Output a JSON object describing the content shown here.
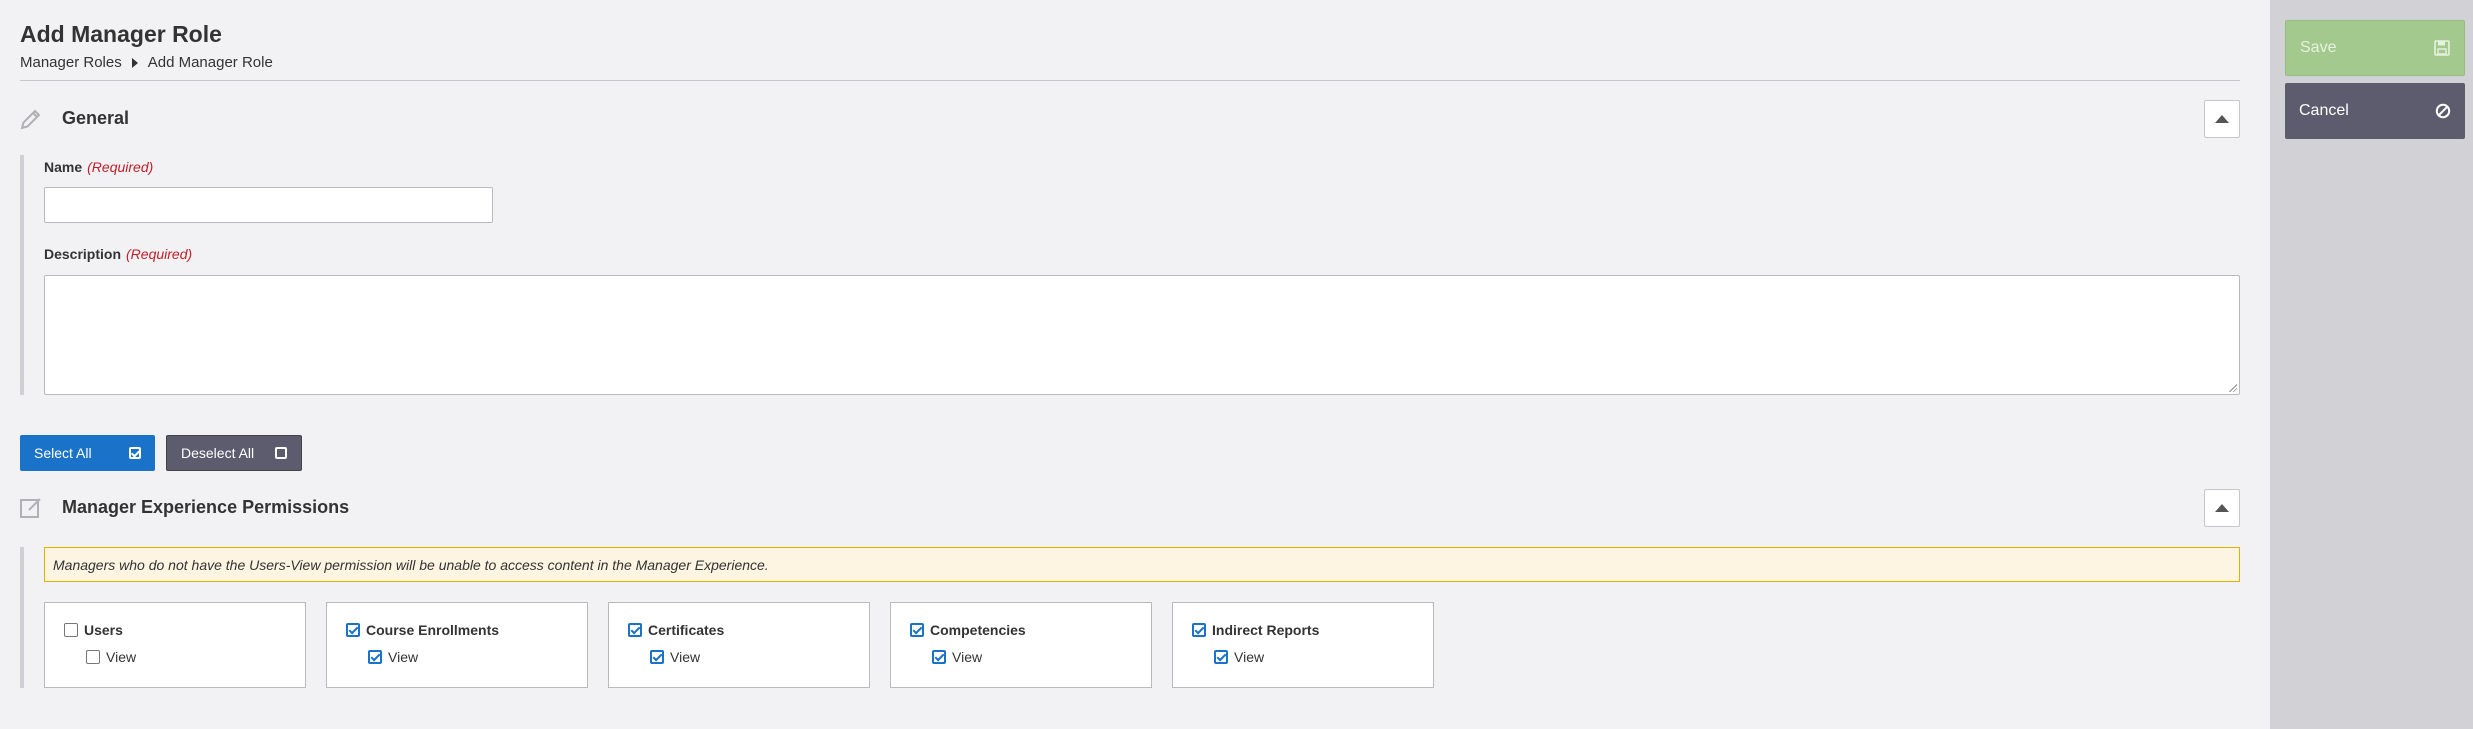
{
  "header": {
    "title": "Add Manager Role",
    "breadcrumb": [
      "Manager Roles",
      "Add Manager Role"
    ]
  },
  "general": {
    "title": "General",
    "name_label": "Name",
    "name_required": "(Required)",
    "name_value": "",
    "description_label": "Description",
    "description_required": "(Required)",
    "description_value": ""
  },
  "bulk_actions": {
    "select_all": "Select All",
    "deselect_all": "Deselect All"
  },
  "permissions": {
    "title": "Manager Experience Permissions",
    "warning": "Managers who do not have the Users-View permission will be unable to access content in the Manager Experience.",
    "groups": [
      {
        "label": "Users",
        "checked": false,
        "sub": {
          "label": "View",
          "checked": false
        }
      },
      {
        "label": "Course Enrollments",
        "checked": true,
        "sub": {
          "label": "View",
          "checked": true
        }
      },
      {
        "label": "Certificates",
        "checked": true,
        "sub": {
          "label": "View",
          "checked": true
        }
      },
      {
        "label": "Competencies",
        "checked": true,
        "sub": {
          "label": "View",
          "checked": true
        }
      },
      {
        "label": "Indirect Reports",
        "checked": true,
        "sub": {
          "label": "View",
          "checked": true
        }
      }
    ]
  },
  "sidebar": {
    "save": "Save",
    "cancel": "Cancel"
  },
  "colors": {
    "primary": "#1a73c8",
    "secondary": "#5c5c6e",
    "save_disabled": "#a4c98f",
    "required": "#c0202a",
    "warning_bg": "#fdf4e2",
    "warning_border": "#e0b000"
  },
  "icons": {
    "general": "pencil-icon",
    "permissions": "edit-square-icon",
    "save": "floppy-disk-icon",
    "cancel": "ban-icon",
    "collapse": "chevron-up-icon",
    "breadcrumb_separator": "caret-right-icon"
  }
}
